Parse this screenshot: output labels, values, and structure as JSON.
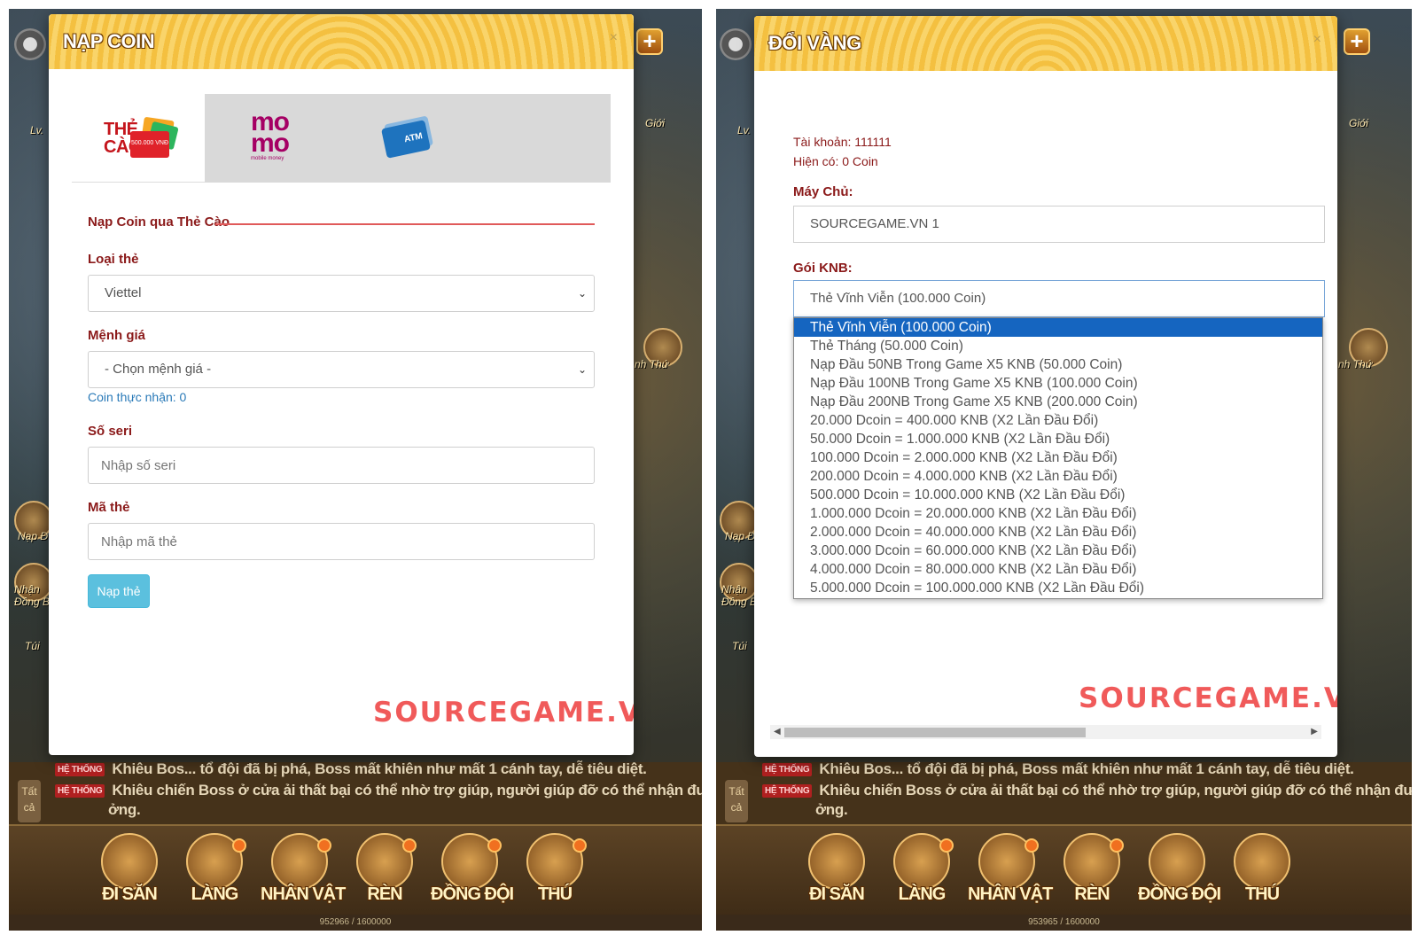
{
  "left": {
    "title": "NẠP COIN",
    "close": "×",
    "tabs": {
      "card_text": "THẺ\nCÀO",
      "card_denom": "500.000 VNĐ",
      "momo_logo": "mo\nmo",
      "momo_sub": "mobile money",
      "atm_text": "ATM"
    },
    "section_title": "Nạp Coin qua Thẻ Cào",
    "card_type_label": "Loại thẻ",
    "card_type_value": "Viettel",
    "denom_label": "Mệnh giá",
    "denom_value": "- Chọn mệnh giá -",
    "coin_note": "Coin thực nhận: 0",
    "serial_label": "Số seri",
    "serial_placeholder": "Nhập số seri",
    "code_label": "Mã thẻ",
    "code_placeholder": "Nhập mã thẻ",
    "submit": "Nạp thẻ",
    "watermark": "SOURCEGAME.VN",
    "game": {
      "chat_tab": "Tất cả",
      "chat_badge": "HỆ THỐNG",
      "chat_line_1": "Khiêu Bos... tổ đội đã bị phá, Boss mất khiên như mất 1 cánh tay, dễ tiêu diệt.",
      "chat_line_2": "Khiêu chiến Boss ở cửa ải thất bại có thể nhờ trợ giúp, người giúp đỡ có thể nhận được nhiều phần thư",
      "chat_line_3": "ởng.",
      "xp": "952966 / 1600000",
      "side_labels": [
        "Lv.",
        "Giới",
        "Nạp Đ",
        "Nhận Đồng B",
        "Túi",
        "nh Thứ"
      ],
      "menu": [
        "ĐI SĂN",
        "LÀNG",
        "NHÂN VẬT",
        "RÈN",
        "ĐỒNG ĐỘI",
        "THÚ"
      ]
    }
  },
  "right": {
    "title": "ĐỔI VÀNG",
    "close": "×",
    "account": "Tài khoản: 111111",
    "balance": "Hiện có: 0 Coin",
    "server_label": "Máy Chủ:",
    "server_value": "SOURCEGAME.VN 1",
    "package_label": "Gói KNB:",
    "package_value": "Thẻ Vĩnh Viễn (100.000 Coin)",
    "options": [
      "Thẻ Vĩnh Viễn (100.000 Coin)",
      "Thẻ Tháng (50.000 Coin)",
      "Nạp Đầu 50NB Trong Game X5 KNB (50.000 Coin)",
      "Nạp Đầu 100NB Trong Game X5 KNB (100.000 Coin)",
      "Nạp Đầu 200NB Trong Game X5 KNB (200.000 Coin)",
      "20.000 Dcoin = 400.000 KNB (X2 Lần Đầu Đổi)",
      "50.000 Dcoin = 1.000.000 KNB (X2 Lần Đầu Đổi)",
      "100.000 Dcoin = 2.000.000 KNB (X2 Lần Đầu Đổi)",
      "200.000 Dcoin = 4.000.000 KNB (X2 Lần Đầu Đổi)",
      "500.000 Dcoin = 10.000.000 KNB (X2 Lần Đầu Đổi)",
      "1.000.000 Dcoin = 20.000.000 KNB (X2 Lần Đầu Đổi)",
      "2.000.000 Dcoin = 40.000.000 KNB (X2 Lần Đầu Đổi)",
      "3.000.000 Dcoin = 60.000.000 KNB (X2 Lần Đầu Đổi)",
      "4.000.000 Dcoin = 80.000.000 KNB (X2 Lần Đầu Đổi)",
      "5.000.000 Dcoin = 100.000.000 KNB (X2 Lần Đầu Đổi)"
    ],
    "watermark": "SOURCEGAME.VN",
    "game": {
      "xp": "953965 / 1600000"
    }
  },
  "colors": {
    "header_gold": "#f5c545",
    "label_maroon": "#8b1a1a",
    "button_info": "#5bc0de",
    "watermark_red": "#f05a5a",
    "selected_blue": "#1565c0"
  }
}
